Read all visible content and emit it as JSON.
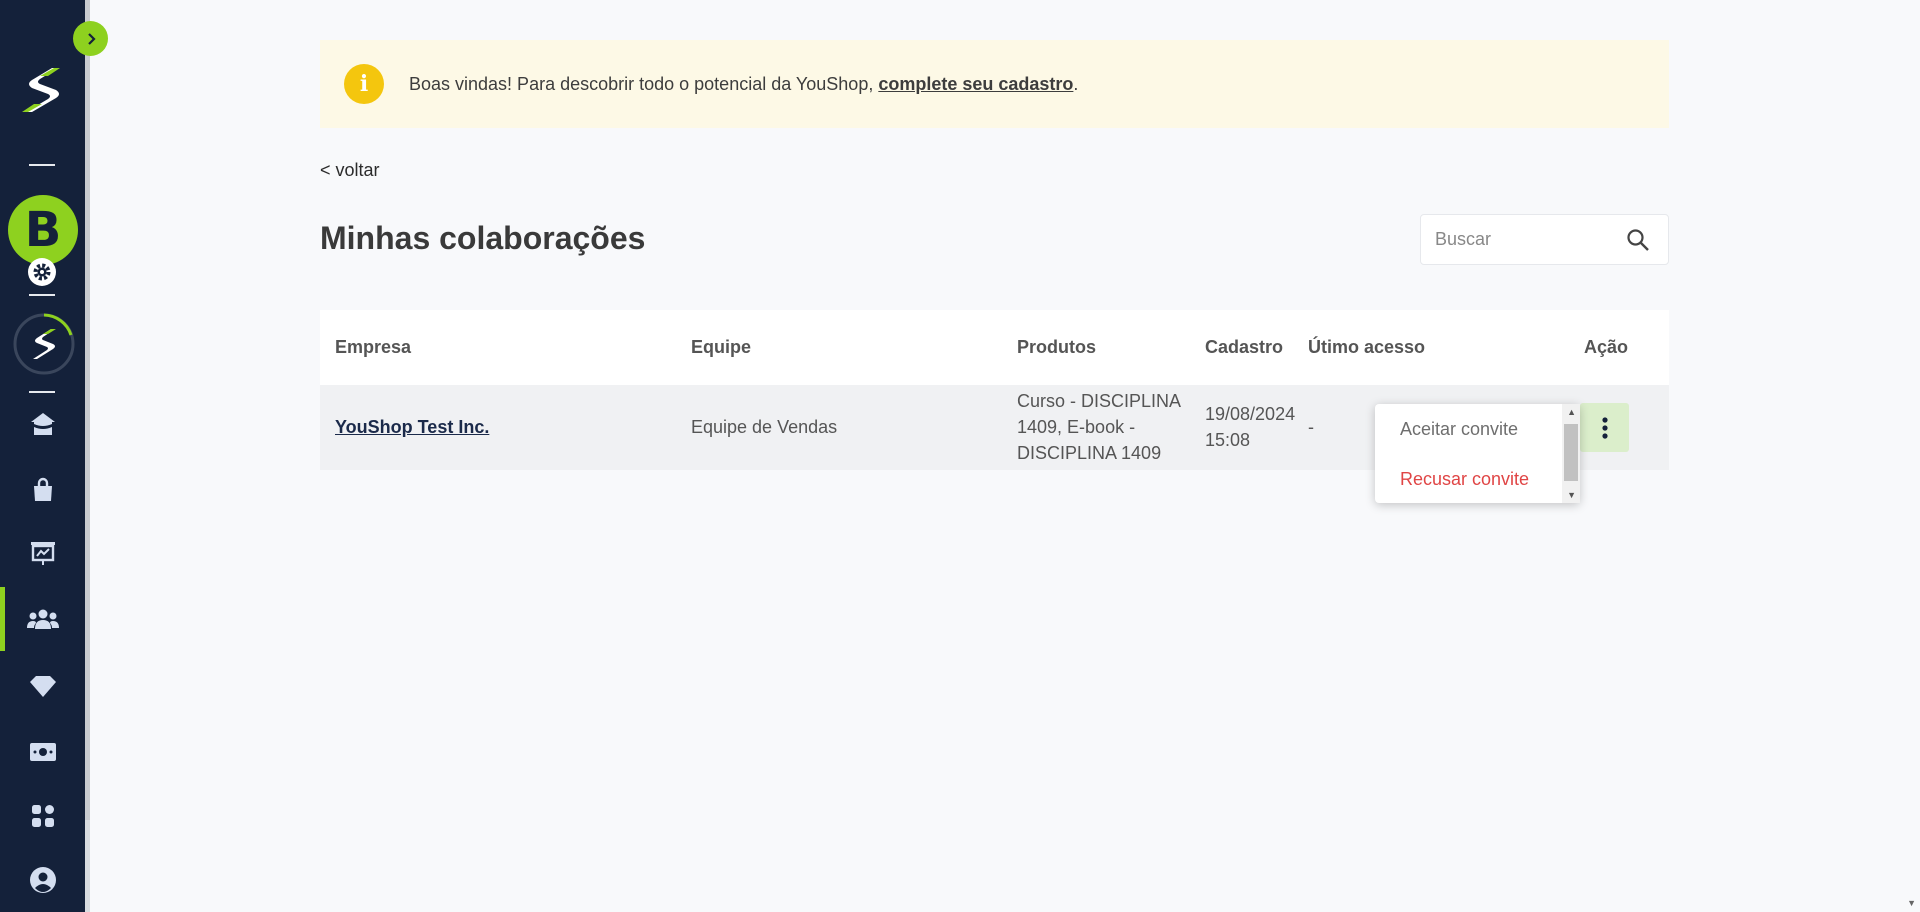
{
  "sidebar": {
    "avatar_letter": "B",
    "items": [
      {
        "icon": "home-icon"
      },
      {
        "icon": "shopping-bag-icon"
      },
      {
        "icon": "presentation-chart-icon"
      },
      {
        "icon": "users-group-icon",
        "active": true
      },
      {
        "icon": "diamond-icon"
      },
      {
        "icon": "dollar-bill-icon"
      },
      {
        "icon": "apps-grid-icon"
      },
      {
        "icon": "user-account-icon"
      }
    ],
    "accent_color": "#8ed11f",
    "background_color": "#14213a"
  },
  "notice": {
    "text": "Boas vindas! Para descobrir todo o potencial da YouShop, ",
    "link": "complete seu cadastro",
    "suffix": ".",
    "icon_glyph": "i"
  },
  "nav": {
    "back_label": "< voltar"
  },
  "page": {
    "title": "Minhas colaborações"
  },
  "search": {
    "placeholder": "Buscar",
    "value": ""
  },
  "table": {
    "headers": {
      "company": "Empresa",
      "team": "Equipe",
      "products": "Produtos",
      "registered": "Cadastro",
      "last_access": "Útimo acesso",
      "action": "Ação"
    },
    "rows": [
      {
        "company": "YouShop Test Inc.",
        "team": "Equipe de Vendas",
        "products_line1": "Curso - DISCIPLINA",
        "products_line2": "1409, E-book -",
        "products_line3": "DISCIPLINA 1409",
        "registered_date": "19/08/2024",
        "registered_time": "15:08",
        "last_access": "-"
      }
    ]
  },
  "dropdown": {
    "accept_label": "Aceitar convite",
    "reject_label": "Recusar convite"
  }
}
